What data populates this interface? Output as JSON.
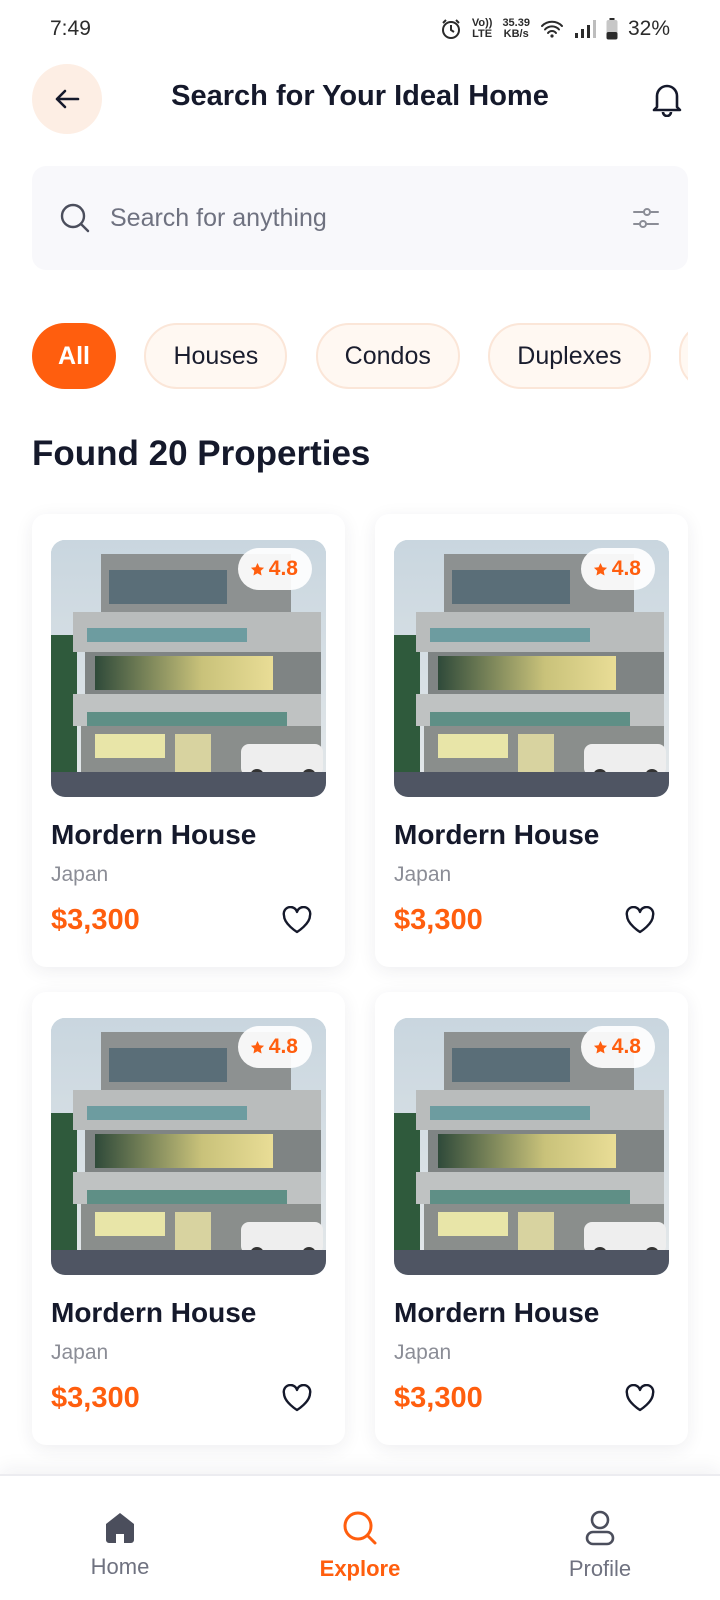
{
  "status_bar": {
    "time": "7:49",
    "network_top": "35.39",
    "network_bottom": "KB/s",
    "volte_top": "Vo))",
    "volte_bottom": "LTE",
    "battery": "32%"
  },
  "header": {
    "title": "Search for Your Ideal Home"
  },
  "search": {
    "placeholder": "Search for anything"
  },
  "categories": [
    {
      "label": "All",
      "active": true
    },
    {
      "label": "Houses",
      "active": false
    },
    {
      "label": "Condos",
      "active": false
    },
    {
      "label": "Duplexes",
      "active": false
    }
  ],
  "results": {
    "title": "Found 20 Properties"
  },
  "properties": [
    {
      "name": "Mordern House",
      "location": "Japan",
      "price": "$3,300",
      "rating": "4.8"
    },
    {
      "name": "Mordern House",
      "location": "Japan",
      "price": "$3,300",
      "rating": "4.8"
    },
    {
      "name": "Mordern House",
      "location": "Japan",
      "price": "$3,300",
      "rating": "4.8"
    },
    {
      "name": "Mordern House",
      "location": "Japan",
      "price": "$3,300",
      "rating": "4.8"
    }
  ],
  "nav": {
    "home": "Home",
    "explore": "Explore",
    "profile": "Profile"
  },
  "colors": {
    "accent": "#ff5e0e",
    "text_dark": "#15192b",
    "muted": "#8b8d96"
  },
  "icons": [
    "back-arrow-icon",
    "bell-icon",
    "search-icon",
    "filter-icon",
    "star-icon",
    "heart-icon",
    "home-icon",
    "explore-icon",
    "profile-icon"
  ]
}
